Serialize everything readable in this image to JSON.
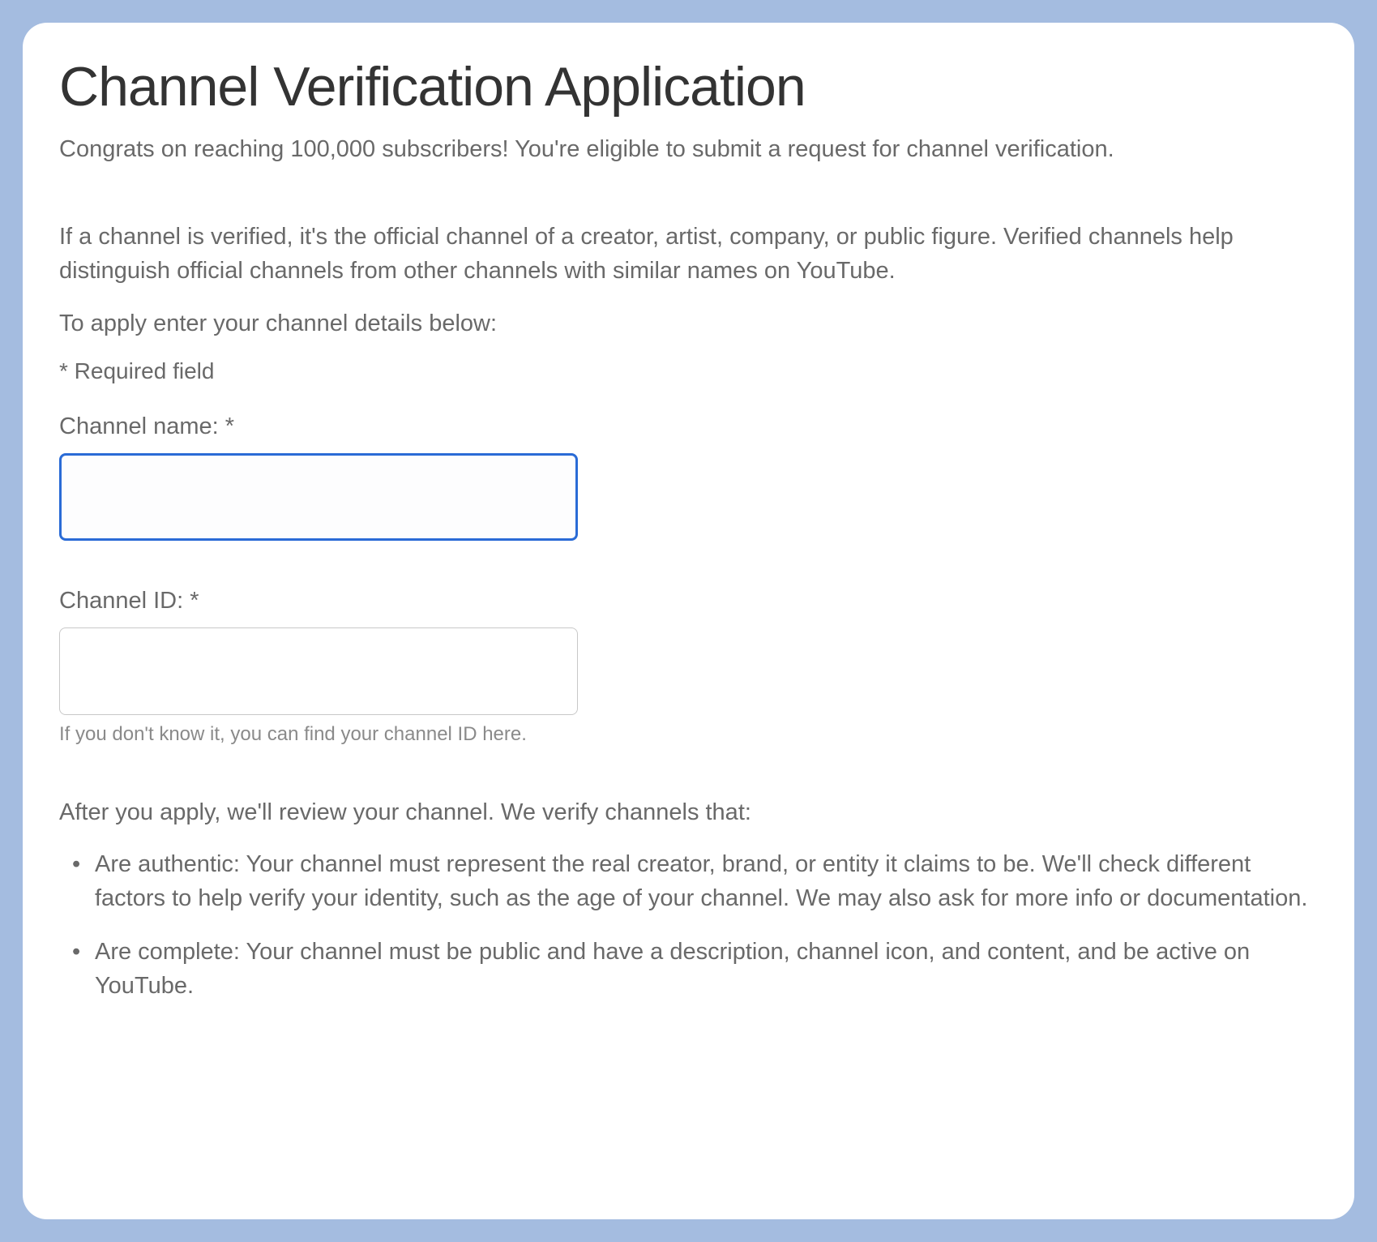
{
  "title": "Channel Verification Application",
  "subheading": "Congrats on reaching 100,000 subscribers! You're eligible to submit a request for channel verification.",
  "intro_paragraph": "If a channel is verified, it's the official channel of a creator, artist, company, or public figure. Verified channels help distinguish official channels from other channels with similar names on YouTube.",
  "apply_line": "To apply enter your channel details below:",
  "required_note": "* Required field",
  "fields": {
    "channel_name": {
      "label": "Channel name: *",
      "value": ""
    },
    "channel_id": {
      "label": "Channel ID: *",
      "value": "",
      "helper": "If you don't know it, you can find your channel ID here."
    }
  },
  "review_intro": "After you apply, we'll review your channel. We verify channels that:",
  "criteria": [
    "Are authentic: Your channel must represent the real creator, brand, or entity it claims to be. We'll check different factors to help verify your identity, such as the age of your channel. We may also ask for more info or documentation.",
    "Are complete: Your channel must be public and have a description, channel icon, and content, and be active on YouTube."
  ]
}
